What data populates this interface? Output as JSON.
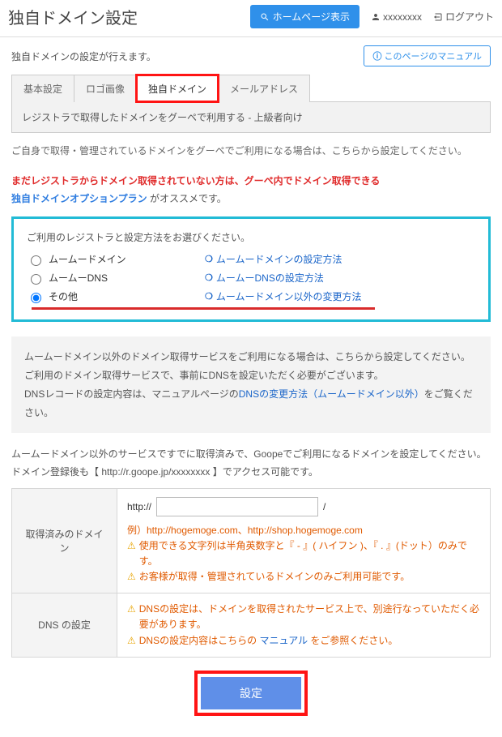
{
  "header": {
    "title": "独自ドメイン設定",
    "homepage_btn": "ホームページ表示",
    "username": "xxxxxxxx",
    "logout": "ログアウト"
  },
  "intro": "独自ドメインの設定が行えます。",
  "manual_btn": "このページのマニュアル",
  "tabs": {
    "basic": "基本設定",
    "logo": "ロゴ画像",
    "domain": "独自ドメイン",
    "mail": "メールアドレス"
  },
  "panel_bar": "レジストラで取得したドメインをグーペで利用する - 上級者向け",
  "self_note": "ご自身で取得・管理されているドメインをグーペでご利用になる場合は、こちらから設定してください。",
  "warning": {
    "line1a": "まだレジストラからドメイン取得されていない方は、グーペ内でドメイン取得できる",
    "line2_blue": "独自ドメインオプションプラン",
    "line2_tail": " がオススメです。"
  },
  "registrar": {
    "lead": "ご利用のレジストラと設定方法をお選びください。",
    "opt1": "ムームードメイン",
    "opt2": "ムームーDNS",
    "opt3": "その他",
    "link1": "ムームードメインの設定方法",
    "link2": "ムームーDNSの設定方法",
    "link3": "ムームードメイン以外の変更方法"
  },
  "graybox": {
    "l1": "ムームードメイン以外のドメイン取得サービスをご利用になる場合は、こちらから設定してください。",
    "l2": "ご利用のドメイン取得サービスで、事前にDNSを設定いただく必要がございます。",
    "l3_a": "DNSレコードの設定内容は、マニュアルページの",
    "l3_link": "DNSの変更方法（ムームードメイン以外）",
    "l3_b": "をご覧ください。"
  },
  "para": {
    "l1": "ムームードメイン以外のサービスですでに取得済みで、Goopeでご利用になるドメインを設定してください。",
    "l2": "ドメイン登録後も【 http://r.goope.jp/xxxxxxxx 】でアクセス可能です。"
  },
  "form": {
    "row1_label": "取得済みのドメイン",
    "protocol": "http://",
    "slash": "/",
    "example": "例）http://hogemoge.com、http://shop.hogemoge.com",
    "warn1": "使用できる文字列は半角英数字と『 - 』( ハイフン )、『 . 』(ドット）のみです。",
    "warn2": "お客様が取得・管理されているドメインのみご利用可能です。",
    "row2_label": "DNS の設定",
    "dns1": "DNSの設定は、ドメインを取得されたサービス上で、別途行なっていただく必要があります。",
    "dns2a": "DNSの設定内容はこちらの ",
    "dns2link": "マニュアル",
    "dns2b": " をご参照ください。"
  },
  "submit": "設定"
}
